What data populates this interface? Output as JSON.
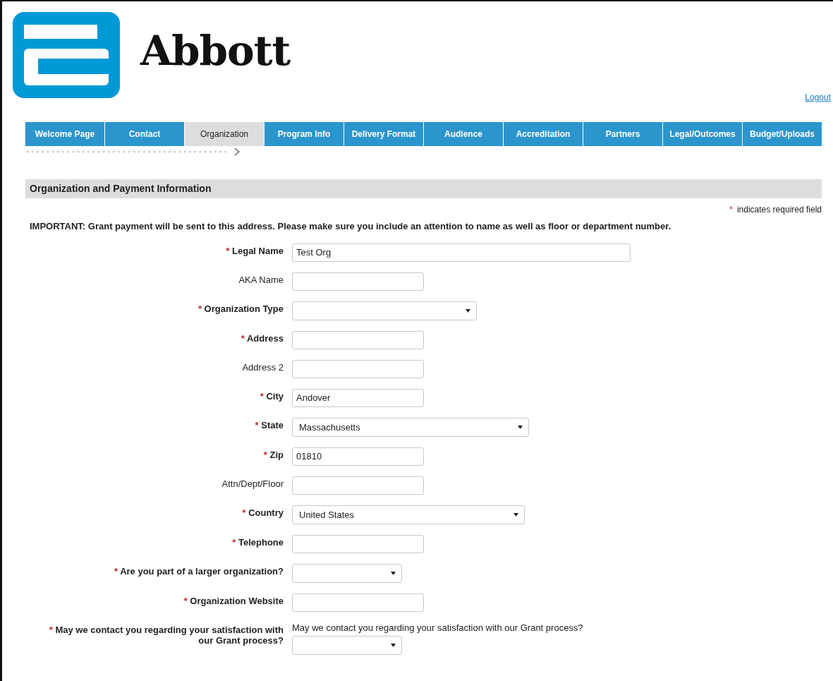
{
  "header": {
    "brand": "Abbott",
    "logout": "Logout"
  },
  "tabs": [
    {
      "label": "Welcome Page",
      "selected": false
    },
    {
      "label": "Contact",
      "selected": false
    },
    {
      "label": "Organization",
      "selected": true
    },
    {
      "label": "Program Info",
      "selected": false
    },
    {
      "label": "Delivery Format",
      "selected": false
    },
    {
      "label": "Audience",
      "selected": false
    },
    {
      "label": "Accreditation",
      "selected": false
    },
    {
      "label": "Partners",
      "selected": false
    },
    {
      "label": "Legal/Outcomes",
      "selected": false
    },
    {
      "label": "Budget/Uploads",
      "selected": false
    }
  ],
  "section": {
    "title": "Organization and Payment Information",
    "required_note": "indicates required field",
    "required_mark": "*",
    "notice": "IMPORTANT: Grant payment will be sent to this address. Please make sure you include an attention to name as well as floor or department number."
  },
  "fields": [
    {
      "label": "Legal Name",
      "required": true,
      "kind": "text",
      "value": "Test Org"
    },
    {
      "label": "AKA Name",
      "required": false,
      "kind": "text"
    },
    {
      "label": "Organization Type",
      "required": true,
      "kind": "select"
    },
    {
      "label": "Address",
      "required": true,
      "kind": "text"
    },
    {
      "label": "Address 2",
      "required": false,
      "kind": "text"
    },
    {
      "label": "City",
      "required": true,
      "kind": "text",
      "value": "Andover"
    },
    {
      "label": "State",
      "required": true,
      "kind": "select",
      "value": "Massachusetts"
    },
    {
      "label": "Zip",
      "required": true,
      "kind": "text",
      "value": "01810"
    },
    {
      "label": "Attn/Dept/Floor",
      "required": false,
      "kind": "text"
    },
    {
      "label": "Country",
      "required": true,
      "kind": "select",
      "value": "United States"
    },
    {
      "label": "Telephone",
      "required": true,
      "kind": "text"
    },
    {
      "label": "Are you part of a larger organization?",
      "required": true,
      "kind": "select"
    },
    {
      "label": "Organization Website",
      "required": true,
      "kind": "text"
    },
    {
      "label": "May we contact you regarding your satisfaction with our Grant process?",
      "required": true,
      "kind": "select",
      "prompt": "May we contact you regarding your satisfaction with our Grant process?"
    }
  ]
}
